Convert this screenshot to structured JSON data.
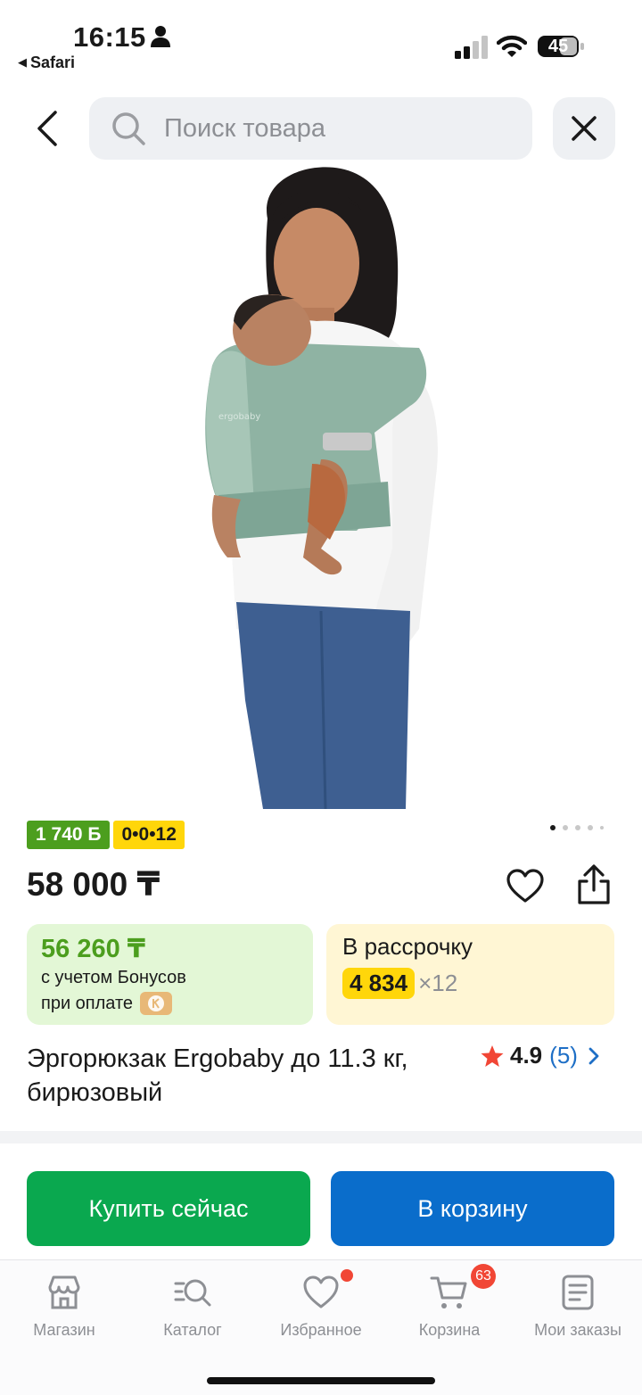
{
  "status_bar": {
    "time": "16:15",
    "back_app": "Safari",
    "battery": "45"
  },
  "header": {
    "search_placeholder": "Поиск товара"
  },
  "product": {
    "bonus_badge": "1 740 Б",
    "installment_badge": "0•0•12",
    "price": "58 000 ₸",
    "bonus_card": {
      "amount": "56 260 ₸",
      "line1": "с учетом Бонусов",
      "line2": "при оплате"
    },
    "rassrochka_card": {
      "title": "В рассрочку",
      "monthly": "4 834",
      "times": "×12"
    },
    "title": "Эргорюкзак Ergobaby до 11.3 кг, бирюзовый",
    "rating": "4.9",
    "reviews": "(5)",
    "gallery": {
      "slides": 5,
      "active": 0
    }
  },
  "actions": {
    "buy_now": "Купить сейчас",
    "add_to_cart": "В корзину"
  },
  "tabbar": {
    "items": [
      {
        "label": "Магазин",
        "icon": "shop-icon"
      },
      {
        "label": "Каталог",
        "icon": "catalog-search-icon"
      },
      {
        "label": "Избранное",
        "icon": "heart-icon"
      },
      {
        "label": "Корзина",
        "icon": "cart-icon",
        "badge": "63"
      },
      {
        "label": "Мои заказы",
        "icon": "orders-icon"
      }
    ]
  },
  "colors": {
    "green": "#0aa84f",
    "blue": "#0a6dcb",
    "bonus_green": "#4c9e1e",
    "yellow": "#ffd60a",
    "badge_red": "#f14635"
  }
}
